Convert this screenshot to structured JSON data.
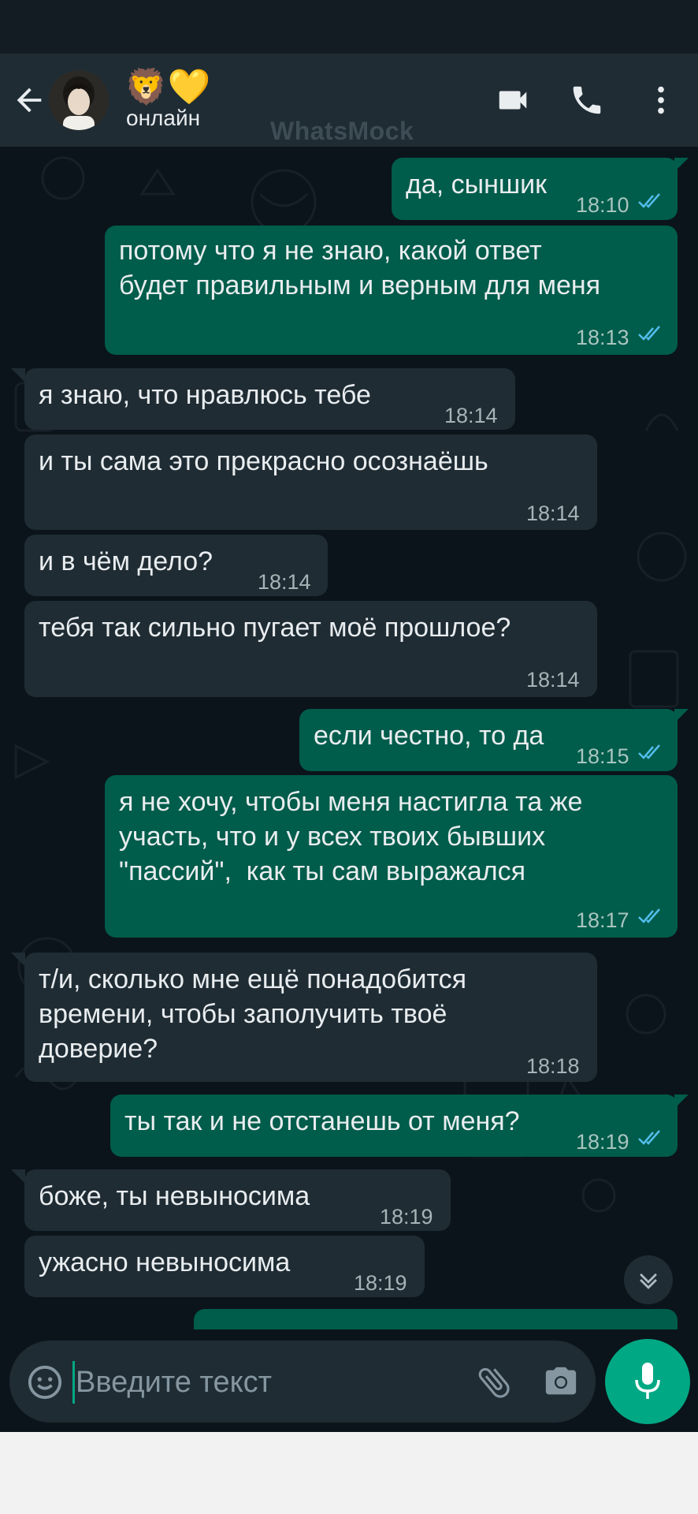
{
  "header": {
    "contact_emoji": "🦁💛",
    "status": "онлайн",
    "watermark": "WhatsMock"
  },
  "messages": [
    {
      "direction": "out",
      "text": "да, сыншик",
      "time": "18:10",
      "read": true
    },
    {
      "direction": "out",
      "text": "потому что я не знаю, какой ответ\nбудет правильным и верным для меня",
      "time": "18:13",
      "read": true
    },
    {
      "direction": "in",
      "text": "я знаю, что нравлюсь тебе",
      "time": "18:14"
    },
    {
      "direction": "in",
      "text": "и ты сама это прекрасно осознаёшь",
      "time": "18:14"
    },
    {
      "direction": "in",
      "text": "и в чём дело?",
      "time": "18:14"
    },
    {
      "direction": "in",
      "text": "тебя так сильно пугает моё прошлое?",
      "time": "18:14"
    },
    {
      "direction": "out",
      "text": "если честно, то да",
      "time": "18:15",
      "read": true
    },
    {
      "direction": "out",
      "text": "я не хочу, чтобы меня настигла та же\nучасть, что и у всех твоих бывших\n\"пассий\",  как ты сам выражался",
      "time": "18:17",
      "read": true
    },
    {
      "direction": "in",
      "text": "т/и, сколько мне ещё понадобится\nвремени, чтобы заполучить твоё\nдоверие?",
      "time": "18:18"
    },
    {
      "direction": "out",
      "text": "ты так и не отстанешь от меня?",
      "time": "18:19",
      "read": true
    },
    {
      "direction": "in",
      "text": "боже, ты невыносима",
      "time": "18:19"
    },
    {
      "direction": "in",
      "text": "ужасно невыносима",
      "time": "18:19"
    }
  ],
  "input": {
    "placeholder": "Введите текст"
  },
  "colors": {
    "outgoing_bubble": "#005c4b",
    "incoming_bubble": "#1f2c34",
    "accent": "#00a884",
    "read_ticks": "#53bdeb",
    "chat_background": "#0b141a"
  },
  "icons": [
    "back-arrow-icon",
    "video-call-icon",
    "phone-icon",
    "more-vert-icon",
    "chevron-down-icon",
    "emoji-icon",
    "attach-icon",
    "camera-icon",
    "mic-icon"
  ]
}
